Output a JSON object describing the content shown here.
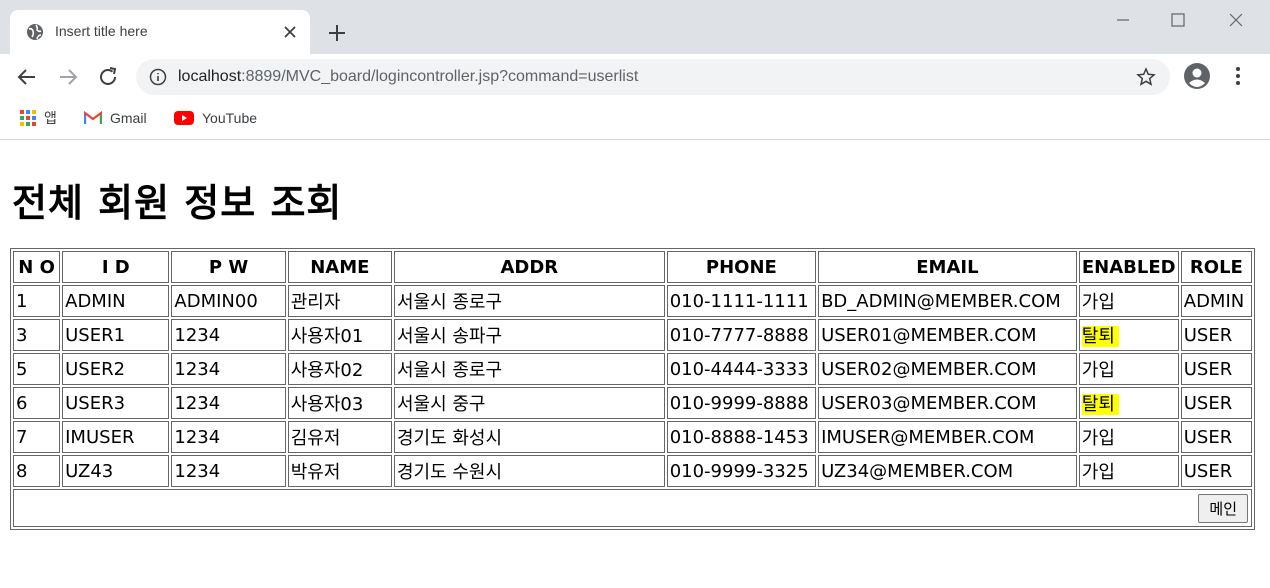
{
  "browser": {
    "tab_title": "Insert title here",
    "url_host": "localhost",
    "url_path": ":8899/MVC_board/logincontroller.jsp?command=userlist",
    "bookmarks": [
      {
        "label": "앱",
        "icon": "apps-icon"
      },
      {
        "label": "Gmail",
        "icon": "gmail-icon"
      },
      {
        "label": "YouTube",
        "icon": "youtube-icon"
      }
    ]
  },
  "page": {
    "title": "전체 회원 정보 조회",
    "columns": [
      "N O",
      "I D",
      "P W",
      "NAME",
      "ADDR",
      "PHONE",
      "EMAIL",
      "ENABLED",
      "ROLE"
    ],
    "rows": [
      {
        "no": "1",
        "id": "ADMIN",
        "pw": "ADMIN00",
        "name": "관리자",
        "addr": "서울시 종로구",
        "phone": "010-1111-1111",
        "email": "BD_ADMIN@MEMBER.COM",
        "enabled": "가입",
        "role": "ADMIN"
      },
      {
        "no": "3",
        "id": "USER1",
        "pw": "1234",
        "name": "사용자01",
        "addr": "서울시 송파구",
        "phone": "010-7777-8888",
        "email": "USER01@MEMBER.COM",
        "enabled": "탈퇴",
        "role": "USER"
      },
      {
        "no": "5",
        "id": "USER2",
        "pw": "1234",
        "name": "사용자02",
        "addr": "서울시 종로구",
        "phone": "010-4444-3333",
        "email": "USER02@MEMBER.COM",
        "enabled": "가입",
        "role": "USER"
      },
      {
        "no": "6",
        "id": "USER3",
        "pw": "1234",
        "name": "사용자03",
        "addr": "서울시 중구",
        "phone": "010-9999-8888",
        "email": "USER03@MEMBER.COM",
        "enabled": "탈퇴",
        "role": "USER"
      },
      {
        "no": "7",
        "id": "IMUSER",
        "pw": "1234",
        "name": "김유저",
        "addr": "경기도 화성시",
        "phone": "010-8888-1453",
        "email": "IMUSER@MEMBER.COM",
        "enabled": "가입",
        "role": "USER"
      },
      {
        "no": "8",
        "id": "UZ43",
        "pw": "1234",
        "name": "박유저",
        "addr": "경기도 수원시",
        "phone": "010-9999-3325",
        "email": "UZ34@MEMBER.COM",
        "enabled": "가입",
        "role": "USER"
      }
    ],
    "withdrawn_value": "탈퇴",
    "highlight_color": "#ffff00",
    "main_button": "메인"
  }
}
